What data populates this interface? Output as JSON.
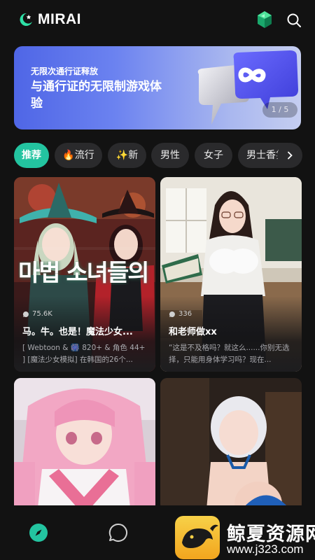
{
  "app": {
    "name": "MIRAI"
  },
  "banner": {
    "subtitle": "无限次通行证释放",
    "title": "与通行证的无限制游戏体验",
    "pager": "1 / 5"
  },
  "tabs": [
    {
      "label": "推荐",
      "active": true
    },
    {
      "label": "🔥流行"
    },
    {
      "label": "✨新"
    },
    {
      "label": "男性"
    },
    {
      "label": "女子"
    },
    {
      "label": "男士香氛"
    }
  ],
  "cards": [
    {
      "image_text": "마법 소녀들의",
      "chat_count": "75.6K",
      "title": "马。牛。也是！魔法少女...",
      "description": "[ Webtoon & 🎆 820+ & 角色 44+ ] [魔法少女模拟] 在韩国的26个..."
    },
    {
      "chat_count": "336",
      "title": "和老师做xx",
      "description": "“这是不及格吗？就这么......你别无选择，只能用身体学习吗？现在..."
    },
    {
      "title": "",
      "description": ""
    },
    {
      "title": "",
      "description": ""
    }
  ],
  "nav": {
    "items": [
      {
        "name": "explore",
        "active": true
      },
      {
        "name": "chat"
      }
    ]
  },
  "watermark": {
    "name": "鲸夏资源网",
    "url": "www.j323.com"
  },
  "colors": {
    "accent": "#23c4a0",
    "background": "#121212",
    "banner_start": "#4f66e6"
  }
}
